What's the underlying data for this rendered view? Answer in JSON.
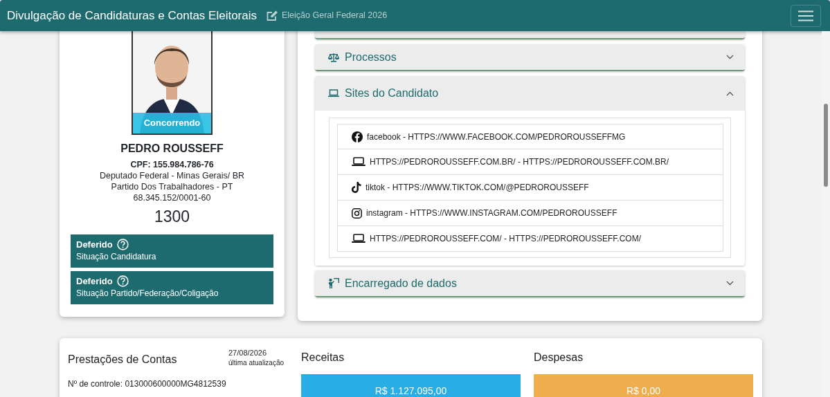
{
  "header": {
    "title": "Divulgação de Candidaturas e Contas Eleitorais",
    "subtitle": "Eleição Geral Federal 2026"
  },
  "candidate": {
    "badge": "Concorrendo",
    "name": "PEDRO ROUSSEFF",
    "cpf": "CPF: 155.984.786-76",
    "lines": [
      "Deputado Federal - Minas Gerais/ BR",
      "Partido Dos Trabalhadores - PT",
      "68.345.152/0001-60"
    ],
    "number": "1300",
    "situations": [
      {
        "status": "Deferido",
        "label": "Situação Candidatura"
      },
      {
        "status": "Deferido",
        "label": "Situação Partido/Federação/Coligação"
      }
    ]
  },
  "accordions": [
    {
      "kind": "scales",
      "title": "Processos",
      "expanded": false
    },
    {
      "kind": "laptop",
      "title": "Sites do Candidato",
      "expanded": true,
      "sites": [
        {
          "kind": "facebook",
          "text": "facebook - HTTPS://WWW.FACEBOOK.COM/PEDROROUSSEFFMG"
        },
        {
          "kind": "web",
          "text": "HTTPS://PEDROROUSSEFF.COM.BR/ - HTTPS://PEDROROUSSEFF.COM.BR/"
        },
        {
          "kind": "tiktok",
          "text": "tiktok - HTTPS://WWW.TIKTOK.COM/@PEDROROUSSEFF"
        },
        {
          "kind": "instagram",
          "text": "instagram - HTTPS://WWW.INSTAGRAM.COM/PEDROROUSSEFF"
        },
        {
          "kind": "web",
          "text": "HTTPS://PEDROROUSSEFF.COM/ - HTTPS://PEDROROUSSEFF.COM/"
        }
      ]
    },
    {
      "kind": "person",
      "title": "Encarregado de dados",
      "expanded": false
    }
  ],
  "accounts": {
    "title": "Prestações de Contas",
    "date": "27/08/2026",
    "date_label": "última atualização",
    "control": "Nº de controle: 013000600000MG4812539",
    "receitas": {
      "title": "Receitas",
      "value": "R$ 1.127.095,00"
    },
    "despesas": {
      "title": "Despesas",
      "value": "R$ 0,00"
    }
  }
}
